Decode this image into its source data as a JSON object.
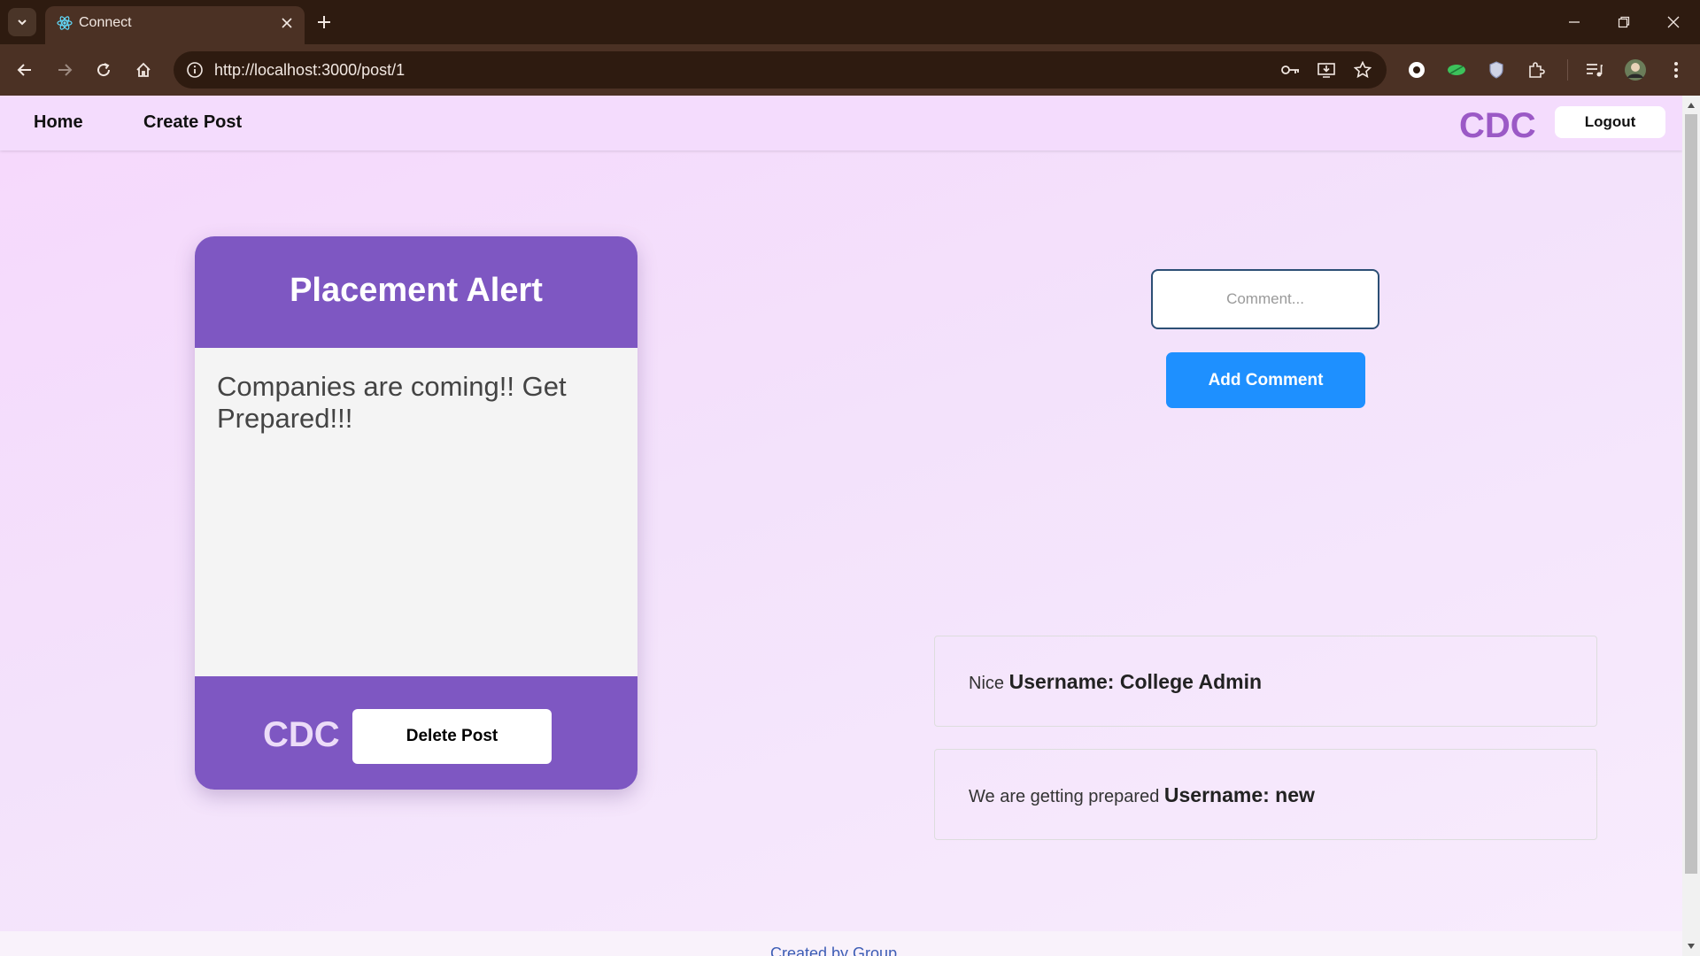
{
  "browser": {
    "tab_title": "Connect",
    "url": "http://localhost:3000/post/1"
  },
  "nav": {
    "home": "Home",
    "create_post": "Create Post",
    "brand": "CDC",
    "logout": "Logout"
  },
  "post": {
    "title": "Placement Alert",
    "body": "Companies are coming!! Get Prepared!!!",
    "author": "CDC",
    "delete_label": "Delete Post"
  },
  "comment_form": {
    "placeholder": "Comment...",
    "submit_label": "Add Comment"
  },
  "comments": [
    {
      "text": "Nice",
      "username": "Username: College Admin"
    },
    {
      "text": "We are getting prepared",
      "username": "Username: new"
    }
  ],
  "footer": {
    "text": "Created by Group..."
  },
  "colors": {
    "card_purple": "#7e57c2",
    "brand_purple": "#9b59c6",
    "primary_blue": "#1e90ff",
    "chrome_brown": "#4b3124"
  }
}
